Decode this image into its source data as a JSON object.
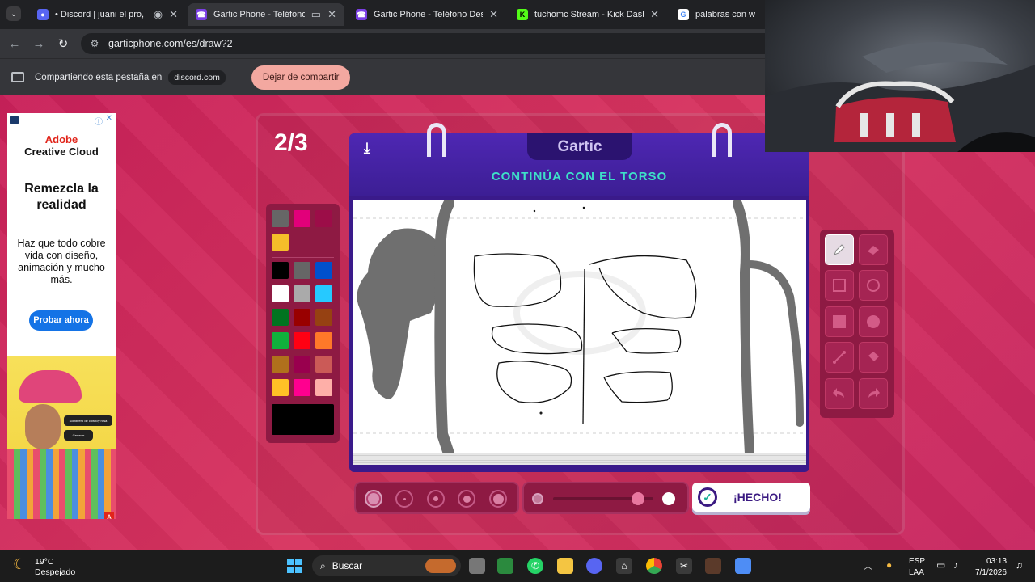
{
  "browser": {
    "tabs": [
      {
        "title": "• Discord | juani el pro, Lov",
        "active": false
      },
      {
        "title": "Gartic Phone - Teléfono De",
        "active": true
      },
      {
        "title": "Gartic Phone - Teléfono Descon",
        "active": false
      },
      {
        "title": "tuchomc Stream - Kick Dashbo",
        "active": false
      },
      {
        "title": "palabras con w en es",
        "active": false
      }
    ],
    "url": "garticphone.com/es/draw?2"
  },
  "sharing": {
    "text": "Compartiendo esta pestaña en",
    "domain": "discord.com",
    "stop_label": "Dejar de compartir"
  },
  "ad": {
    "brand_line1": "Adobe",
    "brand_line2": "Creative Cloud",
    "headline": "Remezcla la realidad",
    "body": "Haz que todo cobre vida con diseño, animación y mucho más.",
    "cta": "Probar ahora",
    "pill1": "Sombrero de cowboy rosa",
    "pill2": "Generar",
    "corner": "A"
  },
  "game": {
    "round": "2/3",
    "logo": "Gartic",
    "prompt": "CONTINÚA CON EL TORSO",
    "done_label": "¡HECHO!",
    "opacity_level": 0.85,
    "selected_color": "#000000",
    "palette_top": [
      "#666666",
      "#e2007a",
      "#9c0d48",
      "#f5be2a"
    ],
    "palette": [
      "#000000",
      "#666666",
      "#0050cd",
      "#ffffff",
      "#aaaaaa",
      "#26c9ff",
      "#017420",
      "#990000",
      "#964112",
      "#11b03c",
      "#ff0013",
      "#ff7829",
      "#b0701c",
      "#99004e",
      "#cb5a57",
      "#ffc126",
      "#ff008f",
      "#feafa8"
    ],
    "tools": [
      "pencil-icon",
      "eraser-icon",
      "square-outline-icon",
      "circle-outline-icon",
      "square-filled-icon",
      "circle-filled-icon",
      "line-icon",
      "fill-bucket-icon",
      "undo-icon",
      "redo-icon"
    ]
  },
  "taskbar": {
    "weather_temp": "19°C",
    "weather_desc": "Despejado",
    "search_label": "Buscar",
    "lang1": "ESP",
    "lang2": "LAA",
    "time": "03:13",
    "date": "7/1/2026"
  }
}
